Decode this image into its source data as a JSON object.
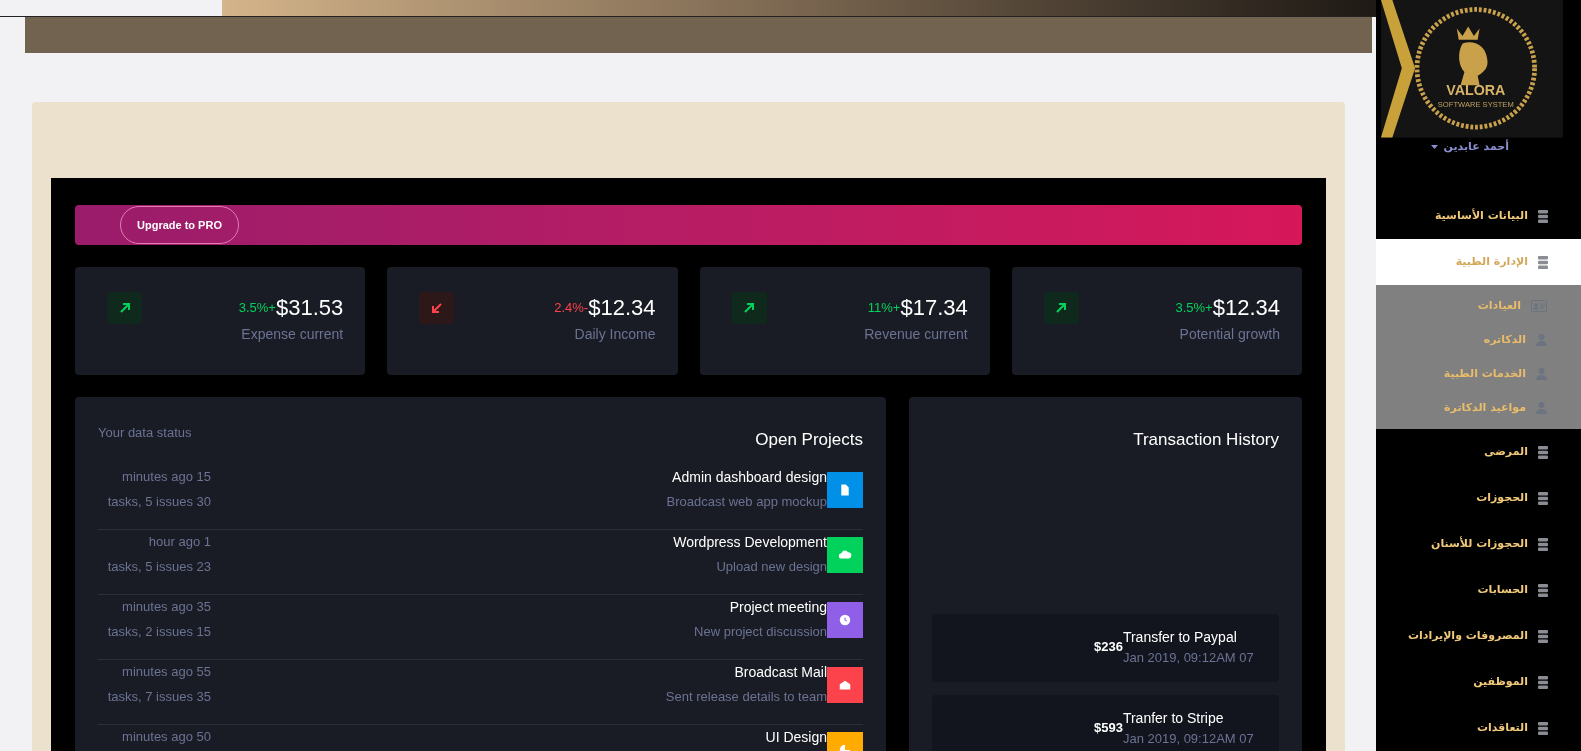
{
  "banner": {
    "button": "Upgrade to PRO"
  },
  "stats": [
    {
      "kind": "up",
      "change": "3.5%+",
      "value": "$31.53",
      "label": "Expense current"
    },
    {
      "kind": "down",
      "change": "2.4%-",
      "value": "$12.34",
      "label": "Daily Income"
    },
    {
      "kind": "up",
      "change": "11%+",
      "value": "$17.34",
      "label": "Revenue current"
    },
    {
      "kind": "up",
      "change": "3.5%+",
      "value": "$12.34",
      "label": "Potential growth"
    }
  ],
  "projects": {
    "subtitle": "Your data status",
    "title": "Open Projects",
    "items": [
      {
        "kind": "document",
        "color": "#0090e7",
        "title": "Admin dashboard design",
        "description": "Broadcast web app mockup",
        "time": "minutes ago 15",
        "tasks": "tasks, 5 issues 30"
      },
      {
        "kind": "cloud",
        "color": "#00d25b",
        "title": "Wordpress Development",
        "description": "Upload new design",
        "time": "hour ago 1",
        "tasks": "tasks, 5 issues 23"
      },
      {
        "kind": "clock",
        "color": "#8f5fe8",
        "title": "Project meeting",
        "description": "New project discussion",
        "time": "minutes ago 35",
        "tasks": "tasks, 2 issues 15"
      },
      {
        "kind": "mail",
        "color": "#fc424a",
        "title": "Broadcast Mail",
        "description": "Sent release details to team",
        "time": "minutes ago 55",
        "tasks": "tasks, 7 issues 35"
      },
      {
        "kind": "chart",
        "color": "#ffab00",
        "title": "UI Design",
        "time": "minutes ago 50"
      }
    ]
  },
  "transactions": {
    "title": "Transaction History",
    "items": [
      {
        "amount": "$236",
        "title": "Transfer to Paypal",
        "date": "Jan 2019, 09:12AM 07"
      },
      {
        "amount": "$593",
        "title": "Tranfer to Stripe",
        "date": "Jan 2019, 09:12AM 07"
      }
    ]
  },
  "sidebar": {
    "logo": {
      "name": "VALORA",
      "tagline": "SOFTWARE SYSTEM"
    },
    "user_name": "أحمد عابدين",
    "items": [
      {
        "label": "البيانات الأساسية",
        "selected": false,
        "expanded": false
      },
      {
        "label": "الإدارة الطبية",
        "selected": true,
        "expanded": true,
        "children": [
          {
            "kind": "card",
            "label": "العيادات"
          },
          {
            "kind": "person",
            "label": "الدكاتره"
          },
          {
            "kind": "person",
            "label": "الخدمات الطبية"
          },
          {
            "kind": "person",
            "label": "مواعيد الدكاترة"
          }
        ]
      },
      {
        "label": "المرضى",
        "selected": false,
        "expanded": false
      },
      {
        "label": "الحجوزات",
        "selected": false,
        "expanded": false
      },
      {
        "label": "الحجوزات للأسنان",
        "selected": false,
        "expanded": false
      },
      {
        "label": "الحسابات",
        "selected": false,
        "expanded": false
      },
      {
        "label": "المصروفات والإيرادات",
        "selected": false,
        "expanded": false
      },
      {
        "label": "الموظفين",
        "selected": false,
        "expanded": false
      },
      {
        "label": "التعاقدات",
        "selected": false,
        "expanded": false
      }
    ]
  }
}
